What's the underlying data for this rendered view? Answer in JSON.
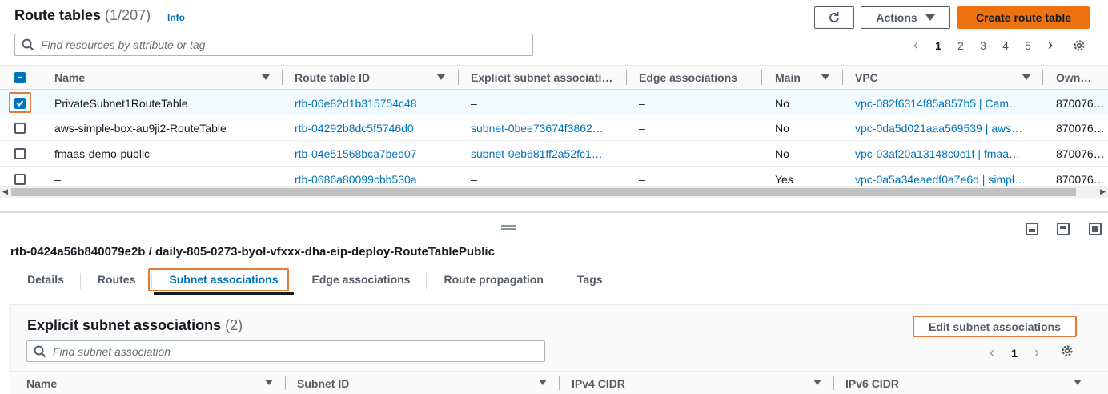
{
  "header": {
    "title": "Route tables",
    "count": "(1/207)",
    "info": "Info",
    "actions_label": "Actions",
    "create_label": "Create route table"
  },
  "search": {
    "placeholder": "Find resources by attribute or tag"
  },
  "pagination": {
    "pages": [
      "1",
      "2",
      "3",
      "4",
      "5"
    ],
    "current": "1"
  },
  "table": {
    "columns": [
      "Name",
      "Route table ID",
      "Explicit subnet associati…",
      "Edge associations",
      "Main",
      "VPC",
      "Own…"
    ],
    "rows": [
      {
        "name": "PrivateSubnet1RouteTable",
        "id": "rtb-06e82d1b315754c48",
        "subnet": "–",
        "edge": "–",
        "main": "No",
        "vpc": "vpc-082f6314f85a857b5 | Cam…",
        "owner": "870076…",
        "selected": true
      },
      {
        "name": "aws-simple-box-au9ji2-RouteTable",
        "id": "rtb-04292b8dc5f5746d0",
        "subnet": "subnet-0bee73674f3862…",
        "edge": "–",
        "main": "No",
        "vpc": "vpc-0da5d021aaa569539 | aws…",
        "owner": "870076…",
        "selected": false
      },
      {
        "name": "fmaas-demo-public",
        "id": "rtb-04e51568bca7bed07",
        "subnet": "subnet-0eb681ff2a52fc1…",
        "edge": "–",
        "main": "No",
        "vpc": "vpc-03af20a13148c0c1f | fmaa…",
        "owner": "870076…",
        "selected": false
      },
      {
        "name": "–",
        "id": "rtb-0686a80099cbb530a",
        "subnet": "–",
        "edge": "–",
        "main": "Yes",
        "vpc": "vpc-0a5a34eaedf0a7e6d | simpl…",
        "owner": "870076…",
        "selected": false
      }
    ]
  },
  "detail": {
    "title": "rtb-0424a56b840079e2b / daily-805-0273-byol-vfxxx-dha-eip-deploy-RouteTablePublic",
    "tabs": [
      "Details",
      "Routes",
      "Subnet associations",
      "Edge associations",
      "Route propagation",
      "Tags"
    ],
    "active_tab": "Subnet associations",
    "section_title": "Explicit subnet associations",
    "section_count": "(2)",
    "edit_label": "Edit subnet associations",
    "search_placeholder": "Find subnet association",
    "page": "1",
    "columns": [
      "Name",
      "Subnet ID",
      "IPv4 CIDR",
      "IPv6 CIDR"
    ]
  },
  "colors": {
    "accent": "#0073bb",
    "primary_button": "#ec7211",
    "highlight": "#e07b39"
  }
}
